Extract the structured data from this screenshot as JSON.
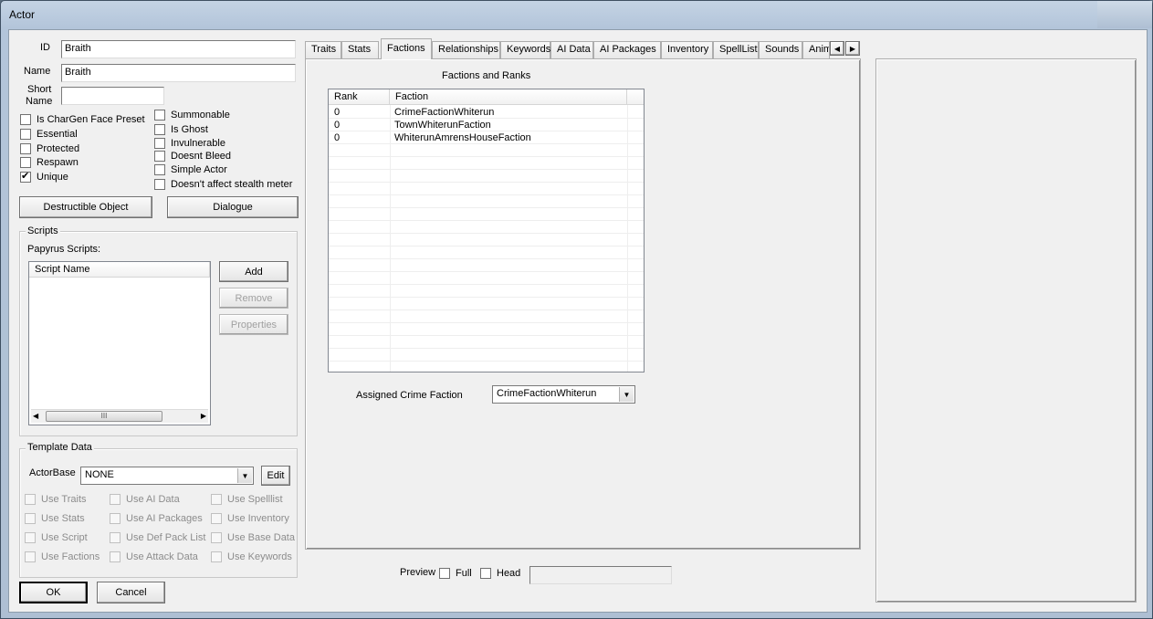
{
  "window": {
    "title": "Actor"
  },
  "fields": {
    "id_label": "ID",
    "id_value": "Braith",
    "name_label": "Name",
    "name_value": "Braith",
    "short_name_label_1": "Short",
    "short_name_label_2": "Name",
    "short_name_value": ""
  },
  "checkboxes_left": [
    {
      "label": "Is CharGen Face Preset",
      "checked": false
    },
    {
      "label": "Essential",
      "checked": false
    },
    {
      "label": "Protected",
      "checked": false
    },
    {
      "label": "Respawn",
      "checked": false
    },
    {
      "label": "Unique",
      "checked": true
    }
  ],
  "checkboxes_right": [
    {
      "label": "Summonable",
      "checked": false
    },
    {
      "label": "Is Ghost",
      "checked": false
    },
    {
      "label": "Invulnerable",
      "checked": false
    },
    {
      "label": "Doesnt Bleed",
      "checked": false
    },
    {
      "label": "Simple Actor",
      "checked": false
    },
    {
      "label": "Doesn't affect stealth meter",
      "checked": false
    }
  ],
  "buttons": {
    "destructible": "Destructible Object",
    "dialogue": "Dialogue"
  },
  "scripts": {
    "group_title": "Scripts",
    "papyrus_label": "Papyrus Scripts:",
    "column": "Script Name",
    "add": "Add",
    "remove": "Remove",
    "properties": "Properties",
    "scroll_grip": "III"
  },
  "template": {
    "group_title": "Template Data",
    "actorbase_label": "ActorBase",
    "actorbase_value": "NONE",
    "edit": "Edit",
    "options": [
      [
        "Use Traits",
        "Use AI Data",
        "Use Spelllist"
      ],
      [
        "Use Stats",
        "Use AI Packages",
        "Use Inventory"
      ],
      [
        "Use Script",
        "Use Def Pack List",
        "Use Base Data"
      ],
      [
        "Use Factions",
        "Use Attack Data",
        "Use Keywords"
      ]
    ]
  },
  "footer": {
    "ok": "OK",
    "cancel": "Cancel"
  },
  "tabs": [
    "Traits",
    "Stats",
    "Factions",
    "Relationships",
    "Keywords",
    "AI Data",
    "AI Packages",
    "Inventory",
    "SpellList",
    "Sounds",
    "Anim"
  ],
  "active_tab": "Factions",
  "factions": {
    "title": "Factions and Ranks",
    "col_rank": "Rank",
    "col_faction": "Faction",
    "rows": [
      {
        "rank": "0",
        "faction": "CrimeFactionWhiterun"
      },
      {
        "rank": "0",
        "faction": "TownWhiterunFaction"
      },
      {
        "rank": "0",
        "faction": "WhiterunAmrensHouseFaction"
      }
    ],
    "crime_label": "Assigned Crime Faction",
    "crime_value": "CrimeFactionWhiterun"
  },
  "preview": {
    "label": "Preview",
    "full": "Full",
    "head": "Head",
    "value": ""
  },
  "icons": {
    "dropdown": "dropdown-arrow-icon",
    "left": "scroll-left-icon",
    "right": "scroll-right-icon",
    "check": "checkmark-icon"
  }
}
